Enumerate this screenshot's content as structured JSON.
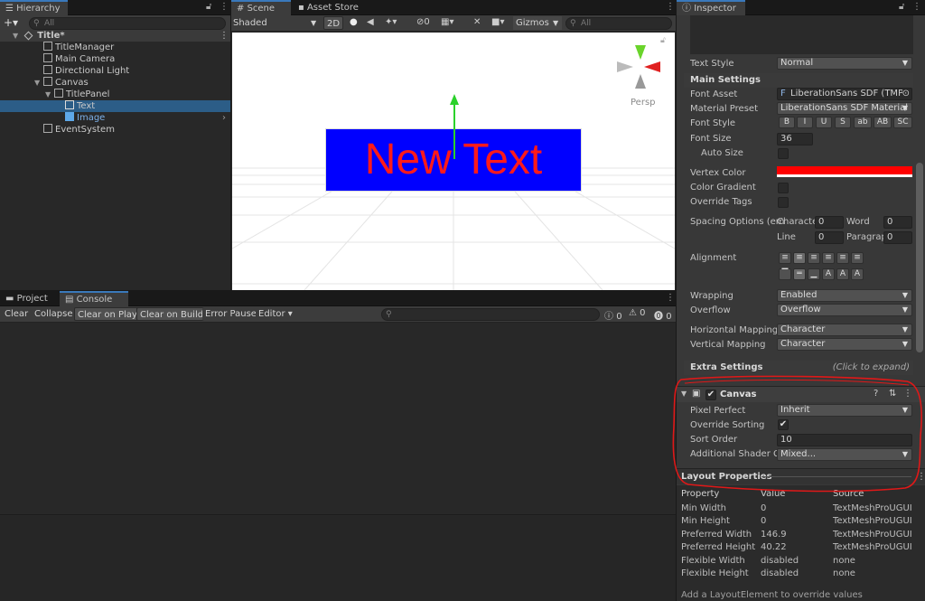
{
  "hierarchy": {
    "tab": "Hierarchy",
    "search_placeholder": "All",
    "add_label": "+▾",
    "items": [
      {
        "label": "Title*",
        "depth": 0
      },
      {
        "label": "TitleManager",
        "depth": 1
      },
      {
        "label": "Main Camera",
        "depth": 1
      },
      {
        "label": "Directional Light",
        "depth": 1
      },
      {
        "label": "Canvas",
        "depth": 1
      },
      {
        "label": "TitlePanel",
        "depth": 2
      },
      {
        "label": "Text",
        "depth": 3
      },
      {
        "label": "Image",
        "depth": 3
      },
      {
        "label": "EventSystem",
        "depth": 1
      }
    ]
  },
  "scene": {
    "tabs": [
      "Scene",
      "Asset Store"
    ],
    "shading": "Shaded",
    "mode_2d": "2D",
    "hidden_count": "0",
    "gizmos": "Gizmos",
    "search_placeholder": "All",
    "persp_label": "Persp",
    "text_object": "New Text",
    "text_color": "#ff1a1a",
    "panel_color": "#0000ff"
  },
  "console": {
    "tabs": [
      "Project",
      "Console"
    ],
    "buttons": [
      "Clear",
      "Collapse",
      "Clear on Play",
      "Clear on Build",
      "Error Pause",
      "Editor ▾"
    ],
    "counts": {
      "log": "0",
      "warn": "0",
      "error": "0"
    }
  },
  "inspector": {
    "tab": "Inspector",
    "text_style": {
      "label": "Text Style",
      "value": "Normal"
    },
    "main_settings": "Main Settings",
    "font_asset": {
      "label": "Font Asset",
      "value": "LiberationSans SDF (TMP_"
    },
    "material_preset": {
      "label": "Material Preset",
      "value": "LiberationSans SDF Material"
    },
    "font_style": {
      "label": "Font Style",
      "buttons": [
        "B",
        "I",
        "U",
        "S",
        "ab",
        "AB",
        "SC"
      ]
    },
    "font_size": {
      "label": "Font Size",
      "value": "36"
    },
    "auto_size": "Auto Size",
    "vertex_color": {
      "label": "Vertex Color",
      "color": "#ff0000"
    },
    "color_gradient": "Color Gradient",
    "override_tags": "Override Tags",
    "spacing": {
      "label": "Spacing Options (em",
      "character": "Characte",
      "character_value": "0",
      "word": "Word",
      "word_value": "0",
      "line": "Line",
      "line_value": "0",
      "paragraph": "Paragrap",
      "paragraph_value": "0"
    },
    "alignment": "Alignment",
    "wrapping": {
      "label": "Wrapping",
      "value": "Enabled"
    },
    "overflow": {
      "label": "Overflow",
      "value": "Overflow"
    },
    "horizontal_mapping": {
      "label": "Horizontal Mapping",
      "value": "Character"
    },
    "vertical_mapping": {
      "label": "Vertical Mapping",
      "value": "Character"
    },
    "extra_settings": "Extra Settings",
    "click_expand": "(Click to expand)",
    "canvas": {
      "title": "Canvas",
      "pixel_perfect": {
        "label": "Pixel Perfect",
        "value": "Inherit"
      },
      "override_sorting": {
        "label": "Override Sorting",
        "checked": "✔"
      },
      "sort_order": {
        "label": "Sort Order",
        "value": "10"
      },
      "additional_shader": {
        "label": "Additional Shader Ch",
        "value": "Mixed..."
      }
    },
    "layout_properties": {
      "title": "Layout Properties",
      "headers": [
        "Property",
        "Value",
        "Source"
      ],
      "rows": [
        [
          "Min Width",
          "0",
          "TextMeshProUGUI"
        ],
        [
          "Min Height",
          "0",
          "TextMeshProUGUI"
        ],
        [
          "Preferred Width",
          "146.9",
          "TextMeshProUGUI"
        ],
        [
          "Preferred Height",
          "40.22",
          "TextMeshProUGUI"
        ],
        [
          "Flexible Width",
          "disabled",
          "none"
        ],
        [
          "Flexible Height",
          "disabled",
          "none"
        ]
      ],
      "footer": "Add a LayoutElement to override values"
    }
  }
}
